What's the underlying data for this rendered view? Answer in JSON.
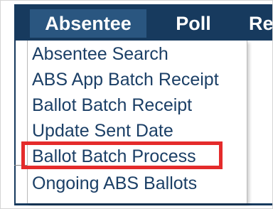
{
  "navbar": {
    "items": [
      {
        "label": "Absentee",
        "active": true
      },
      {
        "label": "Poll",
        "active": false
      },
      {
        "label": "Re",
        "active": false
      }
    ]
  },
  "menu": {
    "items": [
      {
        "label": "Absentee Search"
      },
      {
        "label": "ABS App Batch Receipt"
      },
      {
        "label": "Ballot Batch Receipt"
      },
      {
        "label": "Update Sent Date"
      },
      {
        "label": "Ballot Batch Process",
        "highlighted": true
      },
      {
        "label": "Ongoing ABS Ballots"
      }
    ]
  },
  "colors": {
    "navbar_bg": "#173a5e",
    "active_tab_bg": "#2a5680",
    "menu_text": "#1b3f66",
    "highlight": "#e42b2b"
  }
}
